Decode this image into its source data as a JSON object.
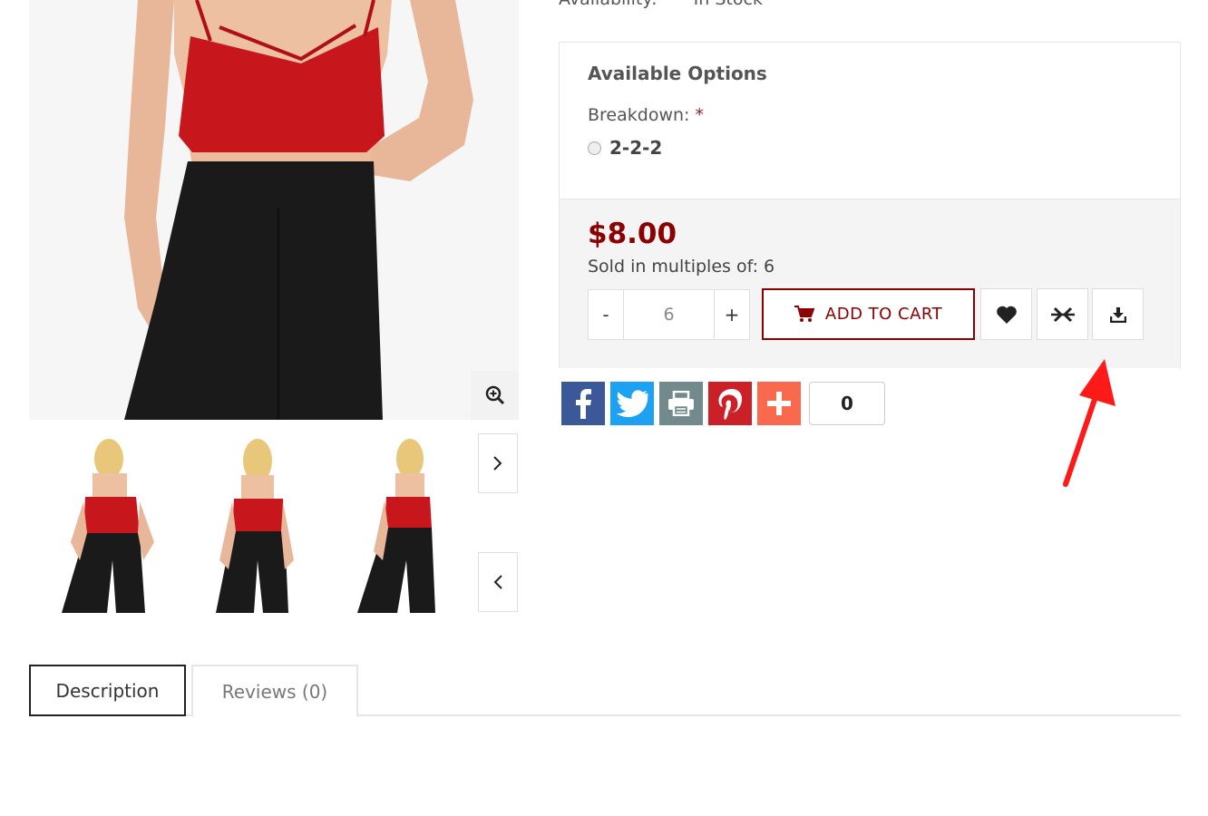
{
  "product": {
    "availability_label": "Availability:",
    "availability_value": "In Stock"
  },
  "options": {
    "title": "Available Options",
    "breakdown_label": "Breakdown:",
    "required_mark": "*",
    "choices": [
      {
        "label": "2-2-2",
        "selected": false
      }
    ]
  },
  "pricing": {
    "price": "$8.00",
    "multiples_text": "Sold in multiples of: 6",
    "quantity": "6",
    "minus_label": "-",
    "plus_label": "+",
    "add_to_cart_label": "ADD TO CART"
  },
  "actions": {
    "wishlist_icon": "heart-icon",
    "compare_icon": "compare-icon",
    "download_icon": "download-icon"
  },
  "share": {
    "buttons": [
      "facebook",
      "twitter",
      "print",
      "pinterest",
      "more"
    ],
    "count": "0",
    "colors": {
      "facebook": "#3b5998",
      "twitter": "#1da1f2",
      "print": "#738a8d",
      "pinterest": "#cb2027",
      "more": "#f8694d"
    }
  },
  "tabs": [
    {
      "label": "Description",
      "active": true
    },
    {
      "label": "Reviews (0)",
      "active": false
    }
  ],
  "colors": {
    "accent": "#8b0000",
    "annotation": "#ff0000"
  }
}
